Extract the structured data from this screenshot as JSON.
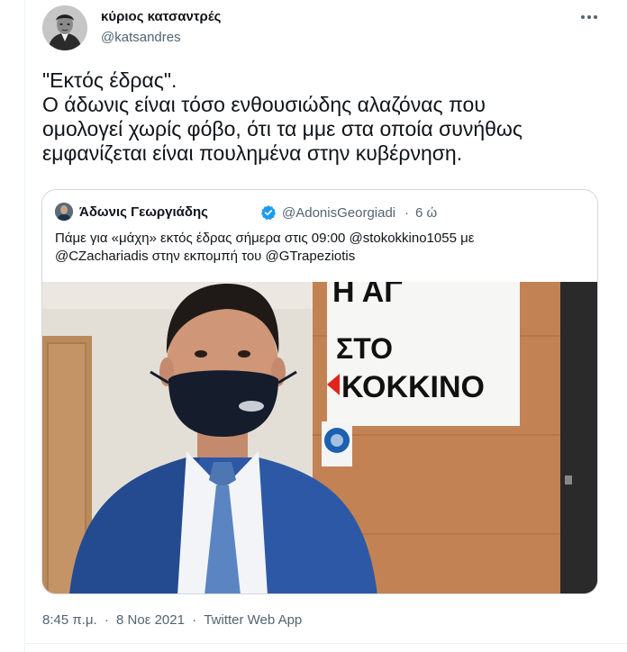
{
  "tweet": {
    "display_name": "κύριος κατσαντρές",
    "handle": "@katsandres",
    "text_lines": [
      "\"Εκτός έδρας\".",
      "Ο άδωνις είναι τόσο ενθουσιώδης αλαζόνας  που",
      "ομολογεί χωρίς φόβο, ότι τα μμε στα οποία συνήθως",
      "εμφανίζεται είναι πουλημένα στην κυβέρνηση."
    ],
    "time": "8:45 π.μ.",
    "separator": "·",
    "date": "8 Νοε 2021",
    "source": "Twitter Web App"
  },
  "quoted": {
    "display_name": "Άδωνις Γεωργιάδης",
    "handle": "@AdonisGeorgiadi",
    "separator": "·",
    "age": "6 ώ",
    "text_lines": [
      "Πάμε για «μάχη» εκτός έδρας σήμερα στις 09:00 @stokokkino1055 με",
      "@CZachariadis στην εκπομπή του @GTrapeziotis"
    ],
    "sign": {
      "line1": "ΣΤΟ",
      "line2": "ΚΟΚΚΙΝΟ",
      "top_partial": "Η ΑΓ"
    }
  },
  "icons": {
    "more": "more-horizontal-icon",
    "verified": "verified-badge-icon"
  },
  "colors": {
    "text": "#0f1419",
    "secondary": "#536471",
    "border": "#cfd9de",
    "verified": "#1d9bf0",
    "sign_red": "#e1251b"
  }
}
